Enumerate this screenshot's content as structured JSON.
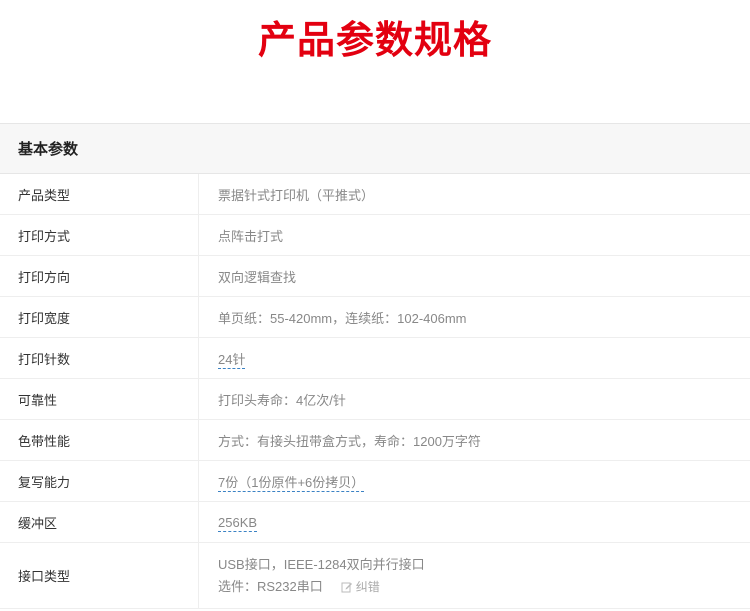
{
  "page_title": "产品参数规格",
  "section": {
    "title": "基本参数"
  },
  "specs": [
    {
      "label": "产品类型",
      "value": "票据针式打印机（平推式）"
    },
    {
      "label": "打印方式",
      "value": "点阵击打式"
    },
    {
      "label": "打印方向",
      "value": "双向逻辑查找"
    },
    {
      "label": "打印宽度",
      "value": "单页纸：55-420mm，连续纸：102-406mm"
    },
    {
      "label": "打印针数",
      "value": "24针"
    },
    {
      "label": "可靠性",
      "value": "打印头寿命：4亿次/针"
    },
    {
      "label": "色带性能",
      "value": "方式：有接头扭带盒方式，寿命：1200万字符"
    },
    {
      "label": "复写能力",
      "value": "7份（1份原件+6份拷贝）"
    },
    {
      "label": "缓冲区",
      "value": "256KB"
    },
    {
      "label": "接口类型",
      "value": "USB接口，IEEE-1284双向并行接口",
      "value2": "选件：RS232串口"
    }
  ],
  "report_error_label": "纠错",
  "colors": {
    "title": "#e30010",
    "link_underline": "#3b82c4",
    "header_bg": "#f7f7f7"
  }
}
